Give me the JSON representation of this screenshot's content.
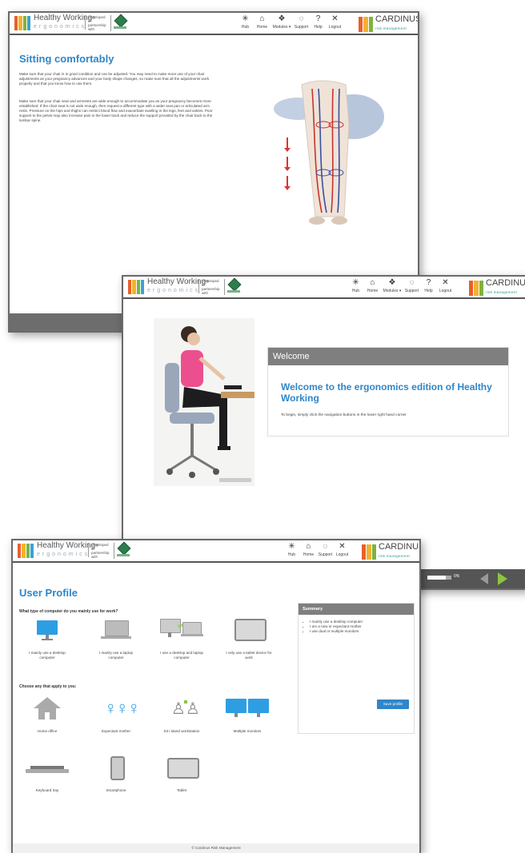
{
  "header": {
    "brand_name": "Healthy Working",
    "brand_tm": "®",
    "brand_sub": "ergonomics",
    "partner_text": "Developed in partnership with",
    "emblem_caption": "",
    "cardinus_name": "CARDINUS",
    "cardinus_sub": "risk management",
    "nav": [
      {
        "label": "Hub",
        "icon": "hub-icon",
        "glyph": "✳"
      },
      {
        "label": "Home",
        "icon": "home-icon",
        "glyph": "⌂"
      },
      {
        "label": "Modules ▾",
        "icon": "modules-icon",
        "glyph": "❖"
      },
      {
        "label": "Support",
        "icon": "support-icon",
        "glyph": "💬"
      },
      {
        "label": "Help",
        "icon": "help-icon",
        "glyph": "?"
      },
      {
        "label": "Logout",
        "icon": "logout-icon",
        "glyph": "✕"
      }
    ],
    "nav_short": [
      {
        "label": "Hub",
        "icon": "hub-icon",
        "glyph": "✳"
      },
      {
        "label": "Home",
        "icon": "home-icon",
        "glyph": "⌂"
      },
      {
        "label": "Support",
        "icon": "support-icon",
        "glyph": "💬"
      },
      {
        "label": "Logout",
        "icon": "logout-icon",
        "glyph": "✕"
      }
    ]
  },
  "colors": {
    "accent": "#2f86c8",
    "logo_bars": [
      "#e8602c",
      "#f2b230",
      "#7fb241",
      "#3aa2d4"
    ],
    "cardinus_bars": [
      "#e8602c",
      "#f2b230",
      "#7fb241"
    ],
    "next": "#8cc43f"
  },
  "sitting": {
    "title": "Sitting comfortably",
    "p1": "Make sure that your chair is in good condition and can be adjusted. You may need to make more use of your chair adjustments as your pregnancy advances and your body shape changes, so make sure that all the adjustments work properly and that you know how to use them.",
    "p2": "Make sure that your chair seat and armrests are wide enough to accommodate you as your pregnancy becomes more established. If the chair seat is not wide enough, then request a different type with a wider seat pan or articulated arm rests. Pressure on the hips and thighs can restrict blood flow and exacerbate swelling in the legs, feet and ankles. Poor support to the pelvis may also increase pain in the lower back and reduce the support provided by the chair back to the lumbar spine."
  },
  "welcome": {
    "header": "Welcome",
    "title": "Welcome to the ergonomics edition of Healthy Working",
    "body": "To begin, simply click the navigation buttons in the lower right hand corner",
    "progress_percent": "0%",
    "progress_value": 0.75
  },
  "profile": {
    "title": "User Profile",
    "q1": "What type of computer do you mainly use for work?",
    "computer_options": [
      "I mainly use a desktop computer",
      "I mainly use a laptop computer",
      "I use a desktop and laptop computer",
      "I only use a tablet device for work"
    ],
    "q2": "Choose any that apply to you:",
    "apply_options": [
      "Home office",
      "Expectant mother",
      "Sit / stand workstation",
      "Multiple monitors",
      "Keyboard tray",
      "Smartphone",
      "Tablet"
    ],
    "summary_title": "Summary",
    "summary_items": [
      "I mainly use a desktop computer",
      "I am a new or expectant mother",
      "I use dual or multiple monitors"
    ],
    "save_label": "Save profile",
    "copyright": "© Cardinus Risk Management"
  }
}
